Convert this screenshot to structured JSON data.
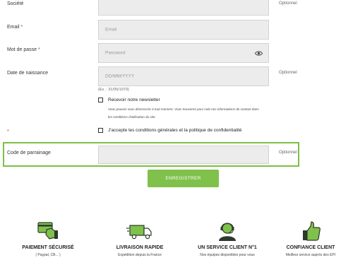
{
  "form": {
    "societe": {
      "label": "Société",
      "optional": "Optionnel"
    },
    "email": {
      "label": "Email",
      "required_mark": "*",
      "placeholder": "Email"
    },
    "password": {
      "label": "Mot de passe",
      "required_mark": "*",
      "placeholder": "Password"
    },
    "birthdate": {
      "label": "Date de naissance",
      "placeholder": "DD/MM/YYYY",
      "example": "(Ex. : 31/05/1970)",
      "optional": "Optionnel"
    },
    "newsletter": {
      "label": "Recevoir notre newsletter",
      "note_line1": "Vous pouvez vous désinscrire à tout moment. Vous trouverez pour cela nos informations de contact dans",
      "note_line2": "les conditions d'utilisation du site."
    },
    "terms": {
      "required_mark": "*",
      "label": "J'accepte les conditions générales et la politique de confidentialité"
    },
    "referral": {
      "label": "Code de parrainage",
      "optional": "Optionnel"
    },
    "submit_label": "ENREGISTRER"
  },
  "features": [
    {
      "icon": "card-hand-icon",
      "title": "PAIEMENT SÉCURISÉ",
      "subtitle": "( Paypal, CB... )"
    },
    {
      "icon": "delivery-truck-icon",
      "title": "LIVRAISON RAPIDE",
      "subtitle": "Expédition depuis la France"
    },
    {
      "icon": "headset-agent-icon",
      "title": "UN SERVICE CLIENT N°1",
      "subtitle": "Nos équipes disponibles pour vous"
    },
    {
      "icon": "thumbs-up-icon",
      "title": "CONFIANCE CLIENT",
      "subtitle": "Meilleur service auprès des EPI"
    }
  ],
  "colors": {
    "accent": "#7fc14b",
    "highlight_border": "#7bc043",
    "required": "#c0392b"
  }
}
